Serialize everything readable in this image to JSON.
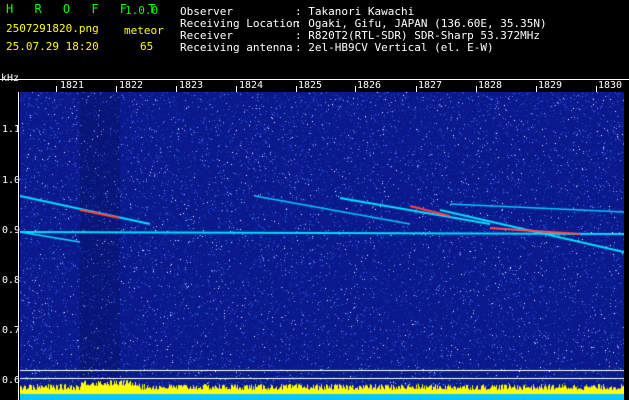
{
  "header": {
    "app_name": "H R O F F T",
    "version": "1.0.0",
    "filename": "2507291820.png",
    "datetime": "25.07.29 18:20",
    "meteor_label": "meteor",
    "meteor_count": "65"
  },
  "info": [
    {
      "label": "Observer",
      "value": ": Takanori Kawachi"
    },
    {
      "label": "Receiving Location",
      "value": ": Ogaki, Gifu, JAPAN (136.60E, 35.35N)"
    },
    {
      "label": "Receiver",
      "value": ": R820T2(RTL-SDR) SDR-Sharp 53.372MHz"
    },
    {
      "label": "Receiving antenna",
      "value": ": 2el-HB9CV Vertical (el. E-W)"
    }
  ],
  "axis": {
    "unit": "kHz",
    "y_ticks": [
      "1.1",
      "1.0",
      "0.9",
      "0.8",
      "0.7",
      "0.6"
    ],
    "x_ticks": [
      "1821",
      "1822",
      "1823",
      "1824",
      "1825",
      "1826",
      "1827",
      "1828",
      "1829",
      "1830"
    ]
  },
  "colors": {
    "background": "#000000",
    "waterfall_base": "#0a1a8c",
    "signal_cyan": "#00ffff",
    "signal_yellow": "#ffff00",
    "signal_red": "#ff2020",
    "text_green": "#00ff00"
  }
}
